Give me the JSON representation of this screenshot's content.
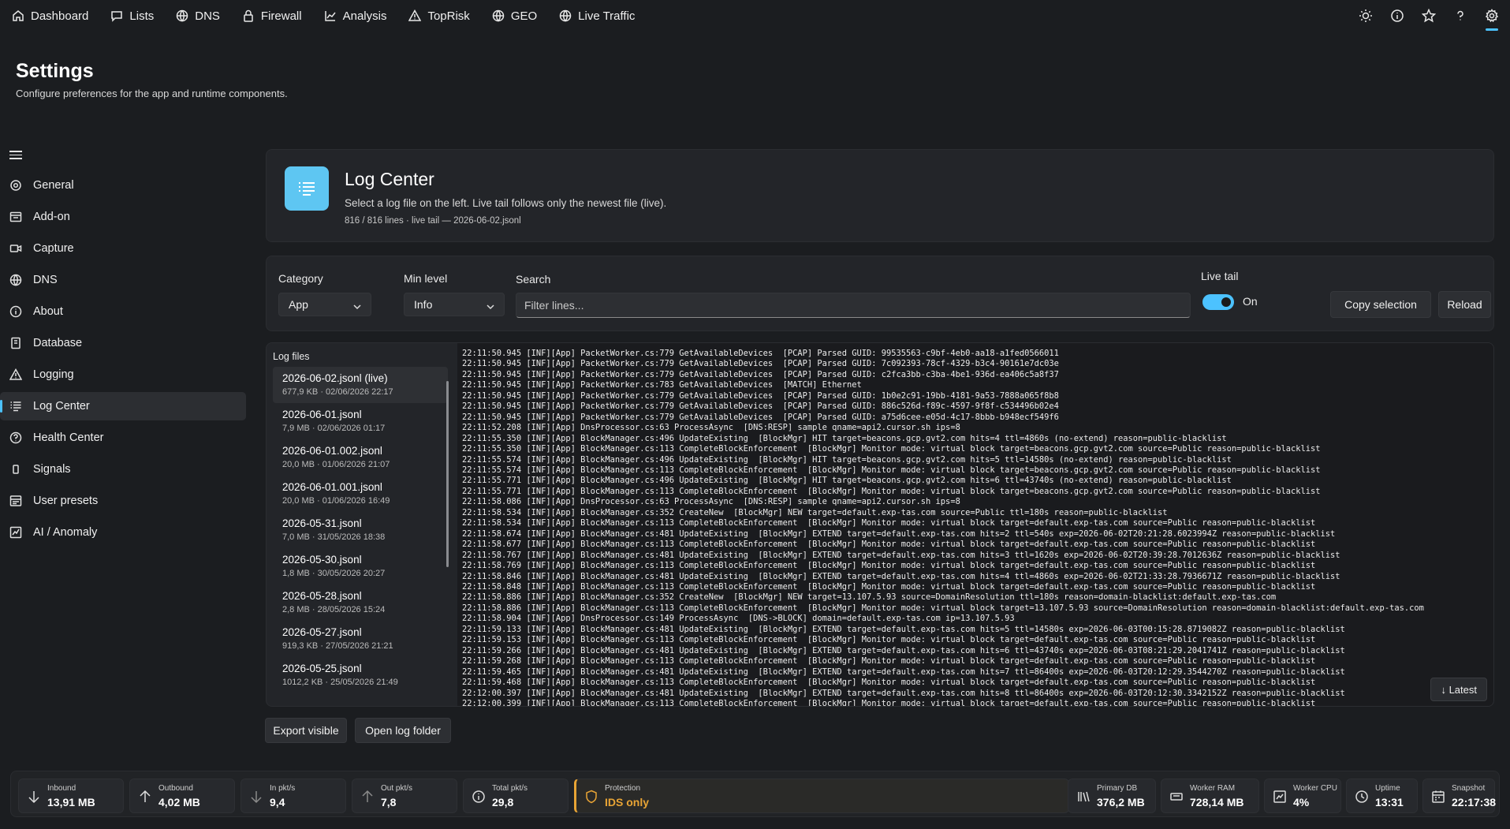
{
  "nav": {
    "items": [
      {
        "label": "Dashboard",
        "icon": "home-icon"
      },
      {
        "label": "Lists",
        "icon": "chat-icon"
      },
      {
        "label": "DNS",
        "icon": "globe-icon"
      },
      {
        "label": "Firewall",
        "icon": "lock-icon"
      },
      {
        "label": "Analysis",
        "icon": "chart-icon"
      },
      {
        "label": "TopRisk",
        "icon": "warning-icon"
      },
      {
        "label": "GEO",
        "icon": "globe-icon"
      },
      {
        "label": "Live Traffic",
        "icon": "globe-icon"
      }
    ],
    "right_icons": [
      "sun-icon",
      "info-icon",
      "star-icon",
      "help-icon",
      "gear-icon"
    ],
    "active_right": "gear-icon"
  },
  "page": {
    "title": "Settings",
    "subtitle": "Configure preferences for the app and runtime components."
  },
  "sidebar": {
    "items": [
      {
        "label": "General",
        "icon": "gear-icon"
      },
      {
        "label": "Add-on",
        "icon": "addon-icon"
      },
      {
        "label": "Capture",
        "icon": "capture-icon"
      },
      {
        "label": "DNS",
        "icon": "globe-icon"
      },
      {
        "label": "About",
        "icon": "info-icon"
      },
      {
        "label": "Database",
        "icon": "database-icon"
      },
      {
        "label": "Logging",
        "icon": "warning-icon"
      },
      {
        "label": "Log Center",
        "icon": "list-icon"
      },
      {
        "label": "Health Center",
        "icon": "help-icon"
      },
      {
        "label": "Signals",
        "icon": "signal-icon"
      },
      {
        "label": "User presets",
        "icon": "presets-icon"
      },
      {
        "label": "AI / Anomaly",
        "icon": "anomaly-icon"
      }
    ],
    "active": "Log Center"
  },
  "hero": {
    "title": "Log Center",
    "description": "Select a log file on the left. Live tail follows only the newest file (live).",
    "meta": "816 / 816 lines · live tail — 2026-06-02.jsonl",
    "accent": "#5ec6f2"
  },
  "filters": {
    "category_label": "Category",
    "category_value": "App",
    "level_label": "Min level",
    "level_value": "Info",
    "search_label": "Search",
    "search_placeholder": "Filter lines...",
    "live_label": "Live tail",
    "live_state": "On",
    "copy_label": "Copy selection",
    "reload_label": "Reload"
  },
  "files": {
    "title": "Log files",
    "items": [
      {
        "name": "2026-06-02.jsonl  (live)",
        "meta": "677,9 KB · 02/06/2026 22:17"
      },
      {
        "name": "2026-06-01.jsonl",
        "meta": "7,9 MB · 02/06/2026 01:17"
      },
      {
        "name": "2026-06-01.002.jsonl",
        "meta": "20,0 MB · 01/06/2026 21:07"
      },
      {
        "name": "2026-06-01.001.jsonl",
        "meta": "20,0 MB · 01/06/2026 16:49"
      },
      {
        "name": "2026-05-31.jsonl",
        "meta": "7,0 MB · 31/05/2026 18:38"
      },
      {
        "name": "2026-05-30.jsonl",
        "meta": "1,8 MB · 30/05/2026 20:27"
      },
      {
        "name": "2026-05-28.jsonl",
        "meta": "2,8 MB · 28/05/2026 15:24"
      },
      {
        "name": "2026-05-27.jsonl",
        "meta": "919,3 KB · 27/05/2026 21:21"
      },
      {
        "name": "2026-05-25.jsonl",
        "meta": "1012,2 KB · 25/05/2026 21:49"
      }
    ]
  },
  "log": {
    "lines": [
      "22:11:50.945 [INF][App] PacketWorker.cs:779 GetAvailableDevices  [PCAP] Parsed GUID: 99535563-c9bf-4eb0-aa18-a1fed0566011",
      "22:11:50.945 [INF][App] PacketWorker.cs:779 GetAvailableDevices  [PCAP] Parsed GUID: 7c092393-78cf-4329-b3c4-90161e7dc03e",
      "22:11:50.945 [INF][App] PacketWorker.cs:779 GetAvailableDevices  [PCAP] Parsed GUID: c2fca3bb-c3ba-4be1-936d-ea406c5a8f37",
      "22:11:50.945 [INF][App] PacketWorker.cs:783 GetAvailableDevices  [MATCH] Ethernet",
      "22:11:50.945 [INF][App] PacketWorker.cs:779 GetAvailableDevices  [PCAP] Parsed GUID: 1b0e2c91-19bb-4181-9a53-7888a065f8b8",
      "22:11:50.945 [INF][App] PacketWorker.cs:779 GetAvailableDevices  [PCAP] Parsed GUID: 886c526d-f89c-4597-9f8f-c534496b02e4",
      "22:11:50.945 [INF][App] PacketWorker.cs:779 GetAvailableDevices  [PCAP] Parsed GUID: a75d6cee-e05d-4c17-8bbb-b948ecf549f6",
      "22:11:52.208 [INF][App] DnsProcessor.cs:63 ProcessAsync  [DNS:RESP] sample qname=api2.cursor.sh ips=8",
      "22:11:55.350 [INF][App] BlockManager.cs:496 UpdateExisting  [BlockMgr] HIT target=beacons.gcp.gvt2.com hits=4 ttl=4860s (no-extend) reason=public-blacklist",
      "22:11:55.350 [INF][App] BlockManager.cs:113 CompleteBlockEnforcement  [BlockMgr] Monitor mode: virtual block target=beacons.gcp.gvt2.com source=Public reason=public-blacklist",
      "22:11:55.574 [INF][App] BlockManager.cs:496 UpdateExisting  [BlockMgr] HIT target=beacons.gcp.gvt2.com hits=5 ttl=14580s (no-extend) reason=public-blacklist",
      "22:11:55.574 [INF][App] BlockManager.cs:113 CompleteBlockEnforcement  [BlockMgr] Monitor mode: virtual block target=beacons.gcp.gvt2.com source=Public reason=public-blacklist",
      "22:11:55.771 [INF][App] BlockManager.cs:496 UpdateExisting  [BlockMgr] HIT target=beacons.gcp.gvt2.com hits=6 ttl=43740s (no-extend) reason=public-blacklist",
      "22:11:55.771 [INF][App] BlockManager.cs:113 CompleteBlockEnforcement  [BlockMgr] Monitor mode: virtual block target=beacons.gcp.gvt2.com source=Public reason=public-blacklist",
      "22:11:58.086 [INF][App] DnsProcessor.cs:63 ProcessAsync  [DNS:RESP] sample qname=api2.cursor.sh ips=8",
      "22:11:58.534 [INF][App] BlockManager.cs:352 CreateNew  [BlockMgr] NEW target=default.exp-tas.com source=Public ttl=180s reason=public-blacklist",
      "22:11:58.534 [INF][App] BlockManager.cs:113 CompleteBlockEnforcement  [BlockMgr] Monitor mode: virtual block target=default.exp-tas.com source=Public reason=public-blacklist",
      "22:11:58.674 [INF][App] BlockManager.cs:481 UpdateExisting  [BlockMgr] EXTEND target=default.exp-tas.com hits=2 ttl=540s exp=2026-06-02T20:21:28.6023994Z reason=public-blacklist",
      "22:11:58.677 [INF][App] BlockManager.cs:113 CompleteBlockEnforcement  [BlockMgr] Monitor mode: virtual block target=default.exp-tas.com source=Public reason=public-blacklist",
      "22:11:58.767 [INF][App] BlockManager.cs:481 UpdateExisting  [BlockMgr] EXTEND target=default.exp-tas.com hits=3 ttl=1620s exp=2026-06-02T20:39:28.7012636Z reason=public-blacklist",
      "22:11:58.769 [INF][App] BlockManager.cs:113 CompleteBlockEnforcement  [BlockMgr] Monitor mode: virtual block target=default.exp-tas.com source=Public reason=public-blacklist",
      "22:11:58.846 [INF][App] BlockManager.cs:481 UpdateExisting  [BlockMgr] EXTEND target=default.exp-tas.com hits=4 ttl=4860s exp=2026-06-02T21:33:28.7936671Z reason=public-blacklist",
      "22:11:58.848 [INF][App] BlockManager.cs:113 CompleteBlockEnforcement  [BlockMgr] Monitor mode: virtual block target=default.exp-tas.com source=Public reason=public-blacklist",
      "22:11:58.886 [INF][App] BlockManager.cs:352 CreateNew  [BlockMgr] NEW target=13.107.5.93 source=DomainResolution ttl=180s reason=domain-blacklist:default.exp-tas.com",
      "22:11:58.886 [INF][App] BlockManager.cs:113 CompleteBlockEnforcement  [BlockMgr] Monitor mode: virtual block target=13.107.5.93 source=DomainResolution reason=domain-blacklist:default.exp-tas.com",
      "22:11:58.904 [INF][App] DnsProcessor.cs:149 ProcessAsync  [DNS->BLOCK] domain=default.exp-tas.com ip=13.107.5.93",
      "22:11:59.133 [INF][App] BlockManager.cs:481 UpdateExisting  [BlockMgr] EXTEND target=default.exp-tas.com hits=5 ttl=14580s exp=2026-06-03T00:15:28.8719082Z reason=public-blacklist",
      "22:11:59.153 [INF][App] BlockManager.cs:113 CompleteBlockEnforcement  [BlockMgr] Monitor mode: virtual block target=default.exp-tas.com source=Public reason=public-blacklist",
      "22:11:59.266 [INF][App] BlockManager.cs:481 UpdateExisting  [BlockMgr] EXTEND target=default.exp-tas.com hits=6 ttl=43740s exp=2026-06-03T08:21:29.2041741Z reason=public-blacklist",
      "22:11:59.268 [INF][App] BlockManager.cs:113 CompleteBlockEnforcement  [BlockMgr] Monitor mode: virtual block target=default.exp-tas.com source=Public reason=public-blacklist",
      "22:11:59.465 [INF][App] BlockManager.cs:481 UpdateExisting  [BlockMgr] EXTEND target=default.exp-tas.com hits=7 ttl=86400s exp=2026-06-03T20:12:29.3544270Z reason=public-blacklist",
      "22:11:59.468 [INF][App] BlockManager.cs:113 CompleteBlockEnforcement  [BlockMgr] Monitor mode: virtual block target=default.exp-tas.com source=Public reason=public-blacklist",
      "22:12:00.397 [INF][App] BlockManager.cs:481 UpdateExisting  [BlockMgr] EXTEND target=default.exp-tas.com hits=8 ttl=86400s exp=2026-06-03T20:12:30.3342152Z reason=public-blacklist",
      "22:12:00.399 [INF][App] BlockManager.cs:113 CompleteBlockEnforcement  [BlockMgr] Monitor mode: virtual block target=default.exp-tas.com source=Public reason=public-blacklist"
    ],
    "latest_label": "↓ Latest"
  },
  "actions": {
    "export_label": "Export visible",
    "open_folder_label": "Open log folder"
  },
  "status": {
    "items": [
      {
        "label": "Inbound",
        "value": "13,91 MB",
        "icon": "arrow-down-icon"
      },
      {
        "label": "Outbound",
        "value": "4,02 MB",
        "icon": "arrow-up-icon"
      },
      {
        "label": "In pkt/s",
        "value": "9,4",
        "icon": "arrow-down-icon"
      },
      {
        "label": "Out pkt/s",
        "value": "7,8",
        "icon": "arrow-up-icon"
      },
      {
        "label": "Total pkt/s",
        "value": "29,8",
        "icon": "info-icon"
      },
      {
        "label": "Protection",
        "value": "IDS only",
        "icon": "shield-icon"
      },
      {
        "label": "Primary DB",
        "value": "376,2 MB",
        "icon": "database-icon"
      },
      {
        "label": "Worker RAM",
        "value": "728,14 MB",
        "icon": "ram-icon"
      },
      {
        "label": "Worker CPU",
        "value": "4%",
        "icon": "cpu-icon"
      },
      {
        "label": "Uptime",
        "value": "13:31",
        "icon": "clock-icon"
      },
      {
        "label": "Snapshot",
        "value": "22:17:38",
        "icon": "calendar-icon"
      }
    ],
    "protection_color": "#e8a435"
  }
}
